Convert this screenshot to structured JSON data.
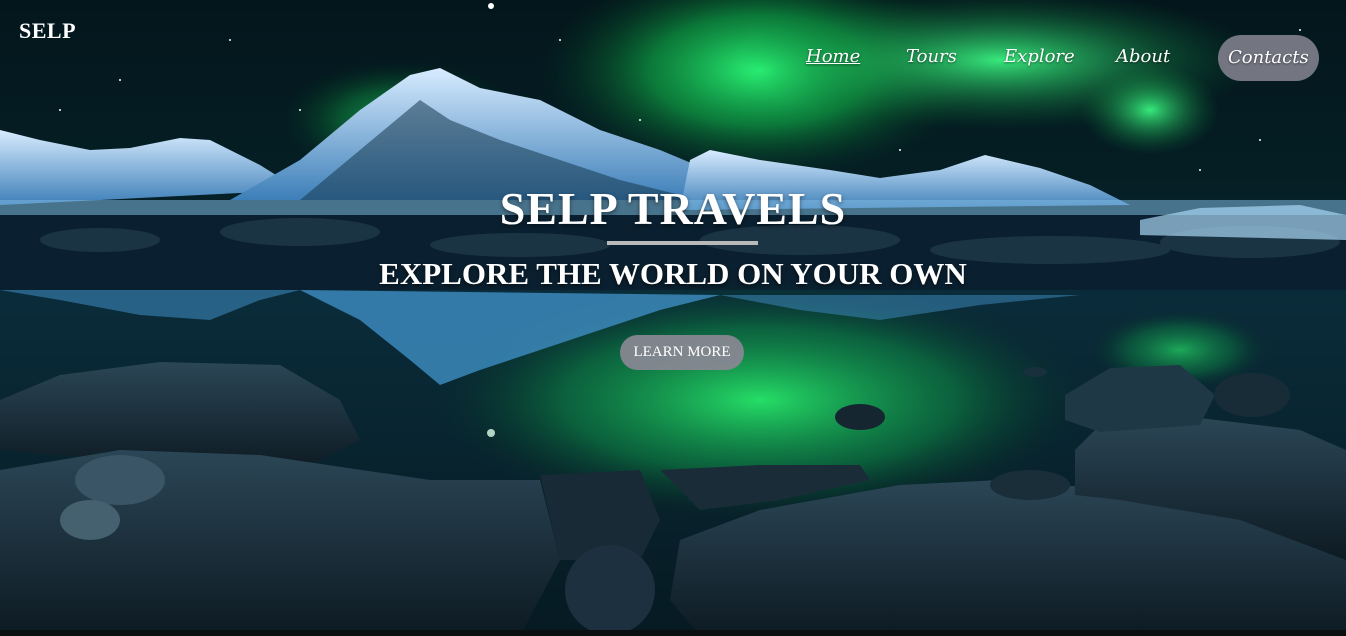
{
  "brand": {
    "logo": "SELP"
  },
  "nav": {
    "items": [
      {
        "label": "Home",
        "active": true
      },
      {
        "label": "Tours",
        "active": false
      },
      {
        "label": "Explore",
        "active": false
      },
      {
        "label": "About",
        "active": false
      },
      {
        "label": "Contacts",
        "active": false,
        "highlighted": true
      }
    ]
  },
  "hero": {
    "title": "SELP TRAVELS",
    "subtitle": "EXPLORE THE WORLD ON YOUR OWN",
    "cta_label": "LEARN MORE",
    "background": "aurora-over-snowy-mountains-and-lake"
  },
  "colors": {
    "aurora_green": "#1fe46a",
    "sky_dark": "#04121b",
    "mountain_blue": "#4fa3d8",
    "pill_gray": "#80808c",
    "text_white": "#ffffff"
  }
}
